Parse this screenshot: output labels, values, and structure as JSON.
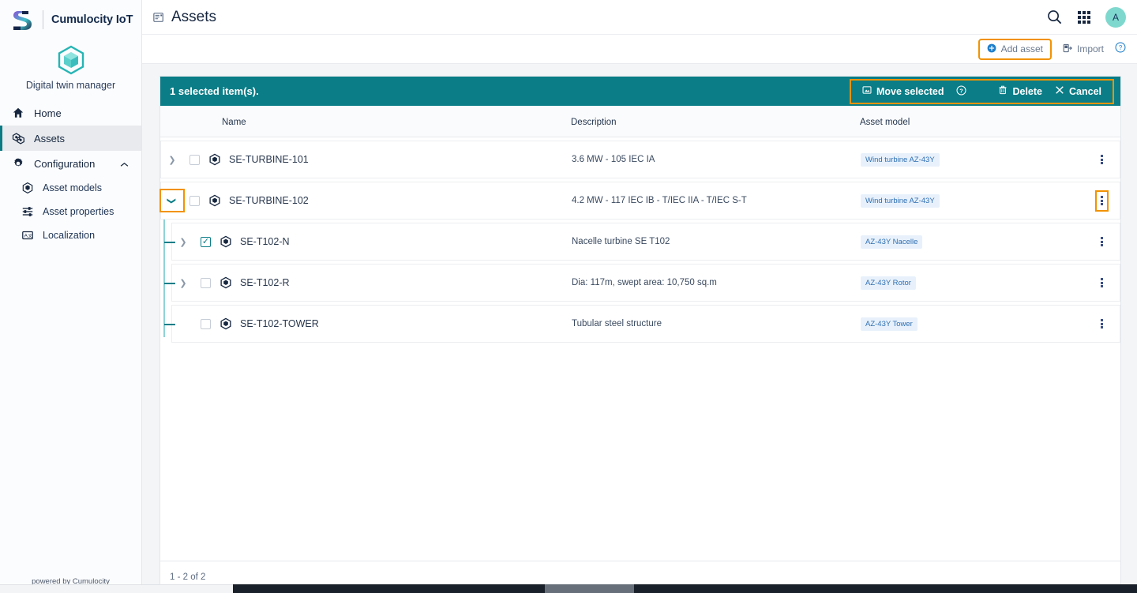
{
  "brand": {
    "name": "Cumulocity IoT",
    "logo_icon": "cumulocity-s-logo"
  },
  "app": {
    "icon": "cube-icon",
    "name": "Digital twin manager"
  },
  "sidebar": {
    "items": [
      {
        "label": "Home",
        "icon": "home-icon",
        "active": false
      },
      {
        "label": "Assets",
        "icon": "assets-icon",
        "active": true
      },
      {
        "label": "Configuration",
        "icon": "gear-icon",
        "active": false,
        "chevron": "chevron-up-icon"
      }
    ],
    "sub_items": [
      {
        "label": "Asset models",
        "icon": "asset-model-icon"
      },
      {
        "label": "Asset properties",
        "icon": "sliders-icon"
      },
      {
        "label": "Localization",
        "icon": "translate-icon"
      }
    ],
    "footer": "powered by Cumulocity"
  },
  "topbar": {
    "menu_icon": "page-list-icon",
    "title": "Assets",
    "search_icon": "search-icon",
    "apps_icon": "app-grid-icon",
    "avatar_initial": "A"
  },
  "actionbar": {
    "add_asset": {
      "label": "Add asset",
      "icon": "plus-circle-icon",
      "highlighted": true
    },
    "import": {
      "label": "Import",
      "icon": "import-icon"
    },
    "help": {
      "icon": "help-circle-icon"
    }
  },
  "selection_bar": {
    "text": "1 selected item(s).",
    "highlighted": true,
    "actions": [
      {
        "label": "Move selected",
        "icon": "move-icon"
      },
      {
        "label": "",
        "icon": "help-circle-icon"
      },
      {
        "label": "Delete",
        "icon": "trash-icon"
      },
      {
        "label": "Cancel",
        "icon": "close-icon"
      }
    ]
  },
  "table": {
    "columns": [
      {
        "key": "name",
        "label": "Name"
      },
      {
        "key": "description",
        "label": "Description"
      },
      {
        "key": "model",
        "label": "Asset model"
      }
    ],
    "rows": [
      {
        "name": "SE-TURBINE-101",
        "description": "3.6 MW - 105 IEC IA",
        "model": "Wind turbine AZ-43Y",
        "level": 0,
        "expanded": false,
        "checked": false,
        "has_children": true,
        "chevron_highlighted": false,
        "kebab_highlighted": false
      },
      {
        "name": "SE-TURBINE-102",
        "description": "4.2 MW - 117 IEC IB - T/IEC IIA - T/IEC S-T",
        "model": "Wind turbine AZ-43Y",
        "level": 0,
        "expanded": true,
        "checked": false,
        "has_children": true,
        "chevron_highlighted": true,
        "kebab_highlighted": true
      },
      {
        "name": "SE-T102-N",
        "description": "Nacelle turbine SE T102",
        "model": "AZ-43Y Nacelle",
        "level": 1,
        "expanded": false,
        "checked": true,
        "has_children": true,
        "chevron_highlighted": false,
        "kebab_highlighted": false
      },
      {
        "name": "SE-T102-R",
        "description": "Dia: 117m, swept area: 10,750 sq.m",
        "model": "AZ-43Y Rotor",
        "level": 1,
        "expanded": false,
        "checked": false,
        "has_children": true,
        "chevron_highlighted": false,
        "kebab_highlighted": false
      },
      {
        "name": "SE-T102-TOWER",
        "description": "Tubular steel structure",
        "model": "AZ-43Y Tower",
        "level": 1,
        "expanded": false,
        "checked": false,
        "has_children": false,
        "chevron_highlighted": false,
        "kebab_highlighted": false
      }
    ],
    "pagination": "1 - 2 of 2"
  },
  "colors": {
    "teal": "#0a7d87",
    "highlight_orange": "#f29200",
    "badge_text": "#2f6fb3",
    "badge_bg": "#e8f1fb",
    "avatar_bg": "#7fd8ce",
    "accent_blue": "#1e7fcb"
  }
}
